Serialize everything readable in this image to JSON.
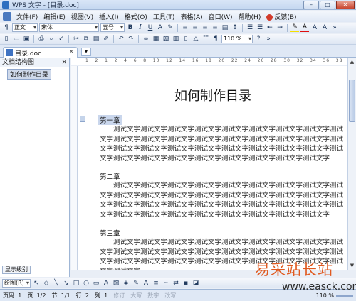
{
  "window": {
    "title": "WPS 文字 - [目录.doc]",
    "controls": [
      "–",
      "□",
      "✕"
    ]
  },
  "menu": {
    "items": [
      "文件(F)",
      "编辑(E)",
      "视图(V)",
      "插入(I)",
      "格式(O)",
      "工具(T)",
      "表格(A)",
      "窗口(W)",
      "帮助(H)"
    ],
    "feedback": "反馈(B)"
  },
  "format_toolbar": {
    "style": "正文",
    "font": "宋体",
    "size": "五号",
    "bold": "B",
    "italic": "I",
    "underline": "U",
    "font_color_glyph": "A"
  },
  "standard_toolbar": {
    "zoom": "110 %"
  },
  "tabs": {
    "active": "目录.doc",
    "close": "×"
  },
  "outline_panel": {
    "title": "文档结构图",
    "close": "×",
    "items": [
      "如何制作目录"
    ],
    "show_level": "显示级别"
  },
  "ruler": {
    "ticks": "1 · 2 · 1 · 2 · 4 · 6 · 8 · 10 · 12 · 14 · 16 · 18 · 20 · 22 · 24 · 26 · 28 · 30 · 32 · 34 · 36 · 38"
  },
  "document": {
    "title": "如何制作目录",
    "chapters": [
      {
        "heading": "第一章",
        "body": "测试文字测试文字测试文字测试文字测试文字测试文字测试文字测试文字测试文字测试文字测试文字测试文字测试文字测试文字测试文字测试文字测试文字测试文字测试文字测试文字测试文字测试文字测试文字测试文字测试文字测试文字测试文字测试文字测试文字测试文字测试文字测试文字测试文字测试文字测试文字"
      },
      {
        "heading": "第二章",
        "body": "测试文字测试文字测试文字测试文字测试文字测试文字测试文字测试文字测试文字测试文字测试文字测试文字测试文字测试文字测试文字测试文字测试文字测试文字测试文字测试文字测试文字测试文字测试文字测试文字测试文字测试文字测试文字测试文字测试文字测试文字测试文字测试文字测试文字测试文字测试文字"
      },
      {
        "heading": "第三章",
        "body": "测试文字测试文字测试文字测试文字测试文字测试文字测试文字测试文字测试文字测试文字测试文字测试文字测试文字测试文字测试文字测试文字测试文字测试文字测试文字测试文字测试文字测试文字测试文字测试文字测试文字测试文字测试文字测试文字"
      }
    ]
  },
  "draw_toolbar": {
    "label": "绘图(R)"
  },
  "status": {
    "page": "页码: 1",
    "pages": "页: 1/2",
    "section": "节: 1/1",
    "row": "行: 2",
    "col": "列: 1",
    "rev": "修订",
    "caps": "大写",
    "num": "数字",
    "ovr": "改写",
    "zoom": "110 %"
  },
  "watermark": {
    "text": "易采站长站",
    "url": "www.easck.com"
  }
}
